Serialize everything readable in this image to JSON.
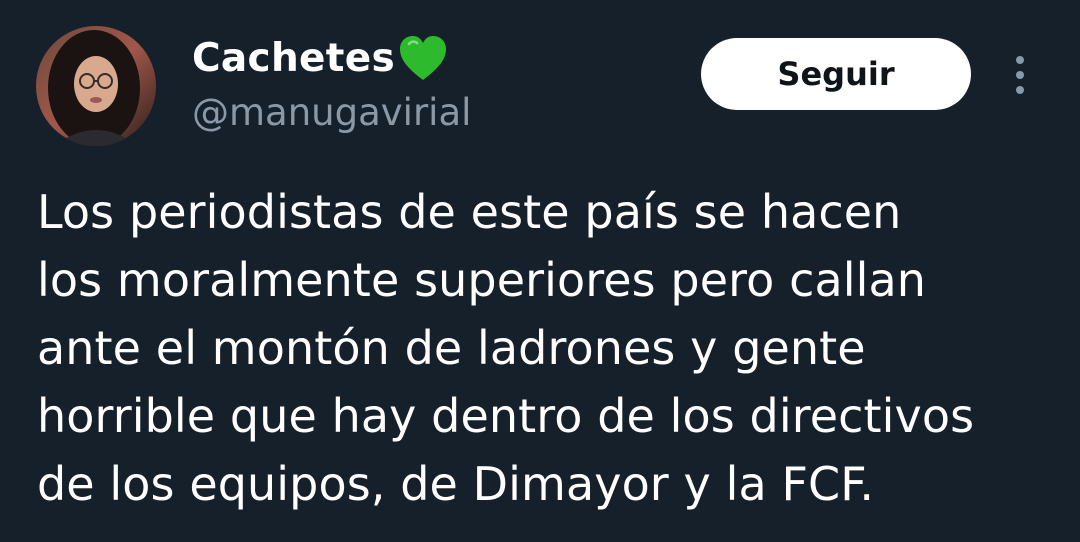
{
  "author": {
    "display_name": "Cachetes",
    "emoji": "green-heart-icon",
    "handle": "@manugavirial"
  },
  "actions": {
    "follow_label": "Seguir",
    "more_icon": "more-vertical-icon"
  },
  "tweet": {
    "lines": [
      "Los periodistas de este país se hacen",
      "los moralmente superiores pero callan",
      "ante el montón de ladrones y gente",
      "horrible que hay dentro de los directivos",
      "de los equipos, de Dimayor y la FCF."
    ]
  },
  "colors": {
    "background": "#15202b",
    "text_primary": "#ffffff",
    "text_secondary": "#8b98a5",
    "heart": "#2dbb2d"
  }
}
